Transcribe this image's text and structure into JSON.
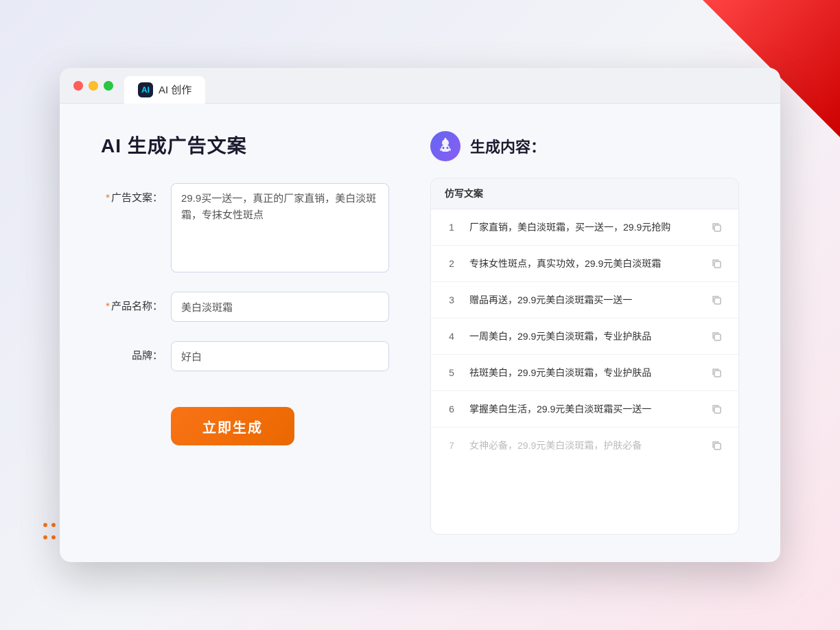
{
  "browser": {
    "tab_label": "AI 创作",
    "tab_icon_text": "AI"
  },
  "left_panel": {
    "title": "AI 生成广告文案",
    "form": {
      "ad_copy_label": "广告文案：",
      "ad_copy_required": "*",
      "ad_copy_value": "29.9买一送一，真正的厂家直销，美白淡斑霜，专抹女性斑点",
      "product_name_label": "产品名称：",
      "product_name_required": "*",
      "product_name_value": "美白淡斑霜",
      "brand_label": "品牌：",
      "brand_value": "好白",
      "generate_btn": "立即生成"
    }
  },
  "right_panel": {
    "title": "生成内容：",
    "table_header": "仿写文案",
    "results": [
      {
        "num": "1",
        "text": "厂家直销，美白淡斑霜，买一送一，29.9元抢购",
        "faded": false
      },
      {
        "num": "2",
        "text": "专抹女性斑点，真实功效，29.9元美白淡斑霜",
        "faded": false
      },
      {
        "num": "3",
        "text": "赠品再送，29.9元美白淡斑霜买一送一",
        "faded": false
      },
      {
        "num": "4",
        "text": "一周美白，29.9元美白淡斑霜，专业护肤品",
        "faded": false
      },
      {
        "num": "5",
        "text": "祛斑美白，29.9元美白淡斑霜，专业护肤品",
        "faded": false
      },
      {
        "num": "6",
        "text": "掌握美白生活，29.9元美白淡斑霜买一送一",
        "faded": false
      },
      {
        "num": "7",
        "text": "女神必备，29.9元美白淡斑霜，护肤必备",
        "faded": true
      }
    ]
  },
  "colors": {
    "orange": "#f97316",
    "purple": "#6366f1",
    "dark": "#1a1a2e"
  }
}
